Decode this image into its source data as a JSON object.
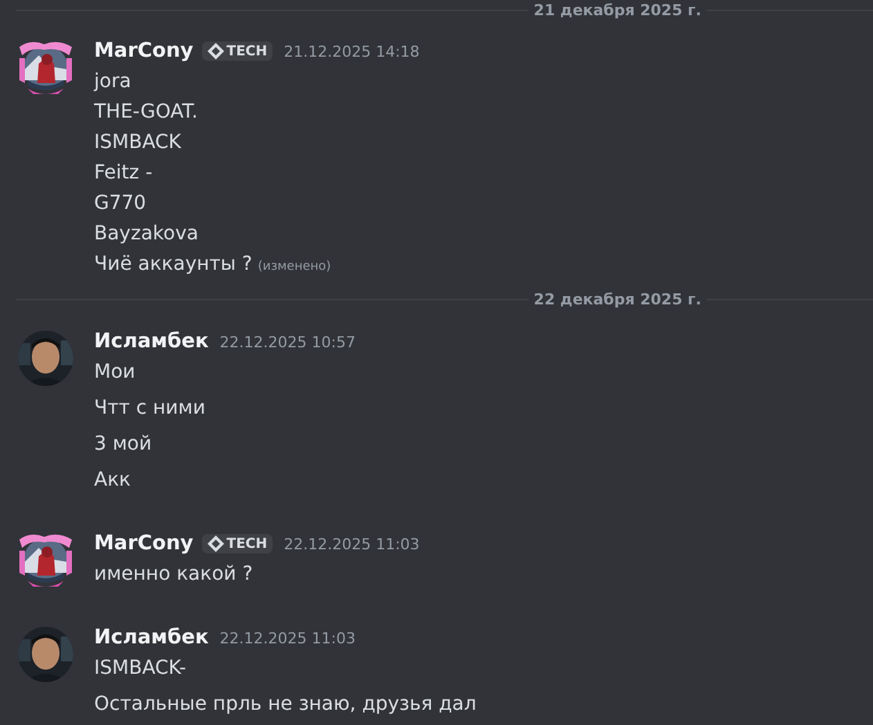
{
  "feed": [
    {
      "kind": "divider",
      "label": "21 декабря 2025 г."
    },
    {
      "kind": "group",
      "author": "MarCony",
      "avatar_frame": true,
      "tag": "TECH",
      "timestamp": "21.12.2025 14:18",
      "messages": [
        {
          "lines": [
            "jora",
            "THE-GOAT.",
            "ISMBACK",
            "Feitz -",
            "G770",
            "Bayzakova",
            "Чиё аккаунты ?"
          ],
          "edited": "(изменено)"
        }
      ]
    },
    {
      "kind": "divider",
      "label": "22 декабря 2025 г."
    },
    {
      "kind": "group",
      "author": "Исламбек",
      "avatar_frame": false,
      "timestamp": "22.12.2025 10:57",
      "messages": [
        {
          "lines": [
            "Мои"
          ]
        },
        {
          "lines": [
            "Чтт с ними"
          ]
        },
        {
          "lines": [
            "3 мой"
          ]
        },
        {
          "lines": [
            "Акк"
          ]
        }
      ]
    },
    {
      "kind": "group",
      "author": "MarCony",
      "avatar_frame": true,
      "tag": "TECH",
      "timestamp": "22.12.2025 11:03",
      "messages": [
        {
          "lines": [
            "именно какой ?"
          ]
        }
      ]
    },
    {
      "kind": "group",
      "author": "Исламбек",
      "avatar_frame": false,
      "timestamp": "22.12.2025 11:03",
      "messages": [
        {
          "lines": [
            "ISMBACK-"
          ]
        },
        {
          "lines": [
            "Остальные прль не знаю, друзья дал"
          ]
        }
      ]
    }
  ]
}
